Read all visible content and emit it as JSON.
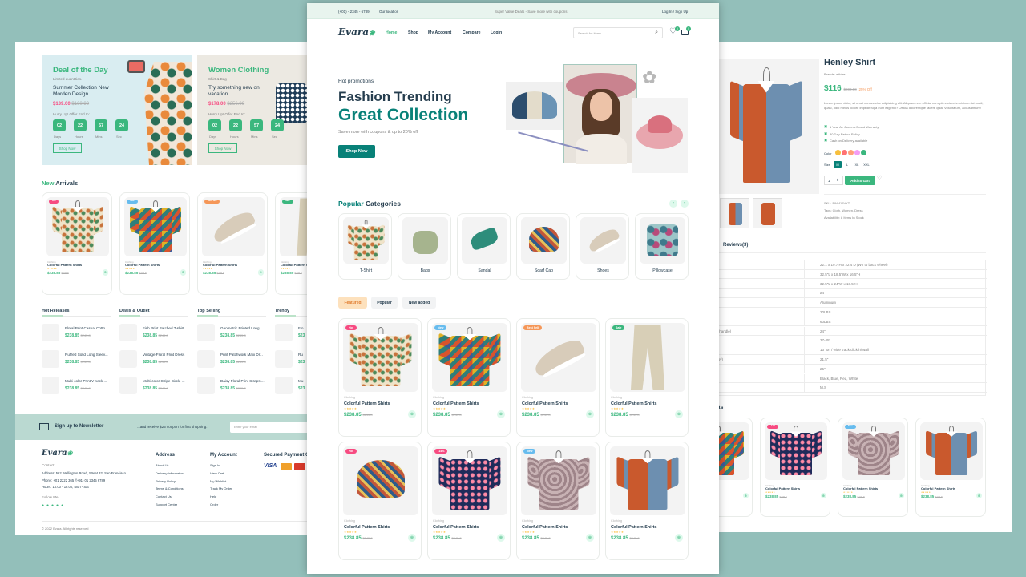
{
  "left": {
    "deal": {
      "title": "Deal of the Day",
      "sub": "Limited quantities.",
      "desc1": "Summer Collection New",
      "desc2": "Morden Design",
      "price": "$139.00",
      "old": "$160.99",
      "hurry": "Hurry Up! Offer End In:",
      "timer": [
        "02",
        "22",
        "57",
        "24"
      ],
      "labels": [
        "Days",
        "Hours",
        "Mins",
        "Sec"
      ],
      "btn": "Shop Now"
    },
    "women": {
      "title": "Women Clothing",
      "sub": "Shirt & Bag",
      "desc1": "Try something new on",
      "desc2": "vacation",
      "price": "$178.00",
      "old": "$256.99",
      "hurry": "Hurry Up! Offer End In:",
      "timer": [
        "02",
        "22",
        "57",
        "24"
      ],
      "labels": [
        "Days",
        "Hours",
        "Mins",
        "Sec"
      ],
      "btn": "Shop Now"
    },
    "arrivals_word1": "New",
    "arrivals_word2": "Arrivals",
    "cards": [
      {
        "badge": "Hot",
        "badge_color": "#f74b81",
        "cat": "Clothing",
        "name": "Colorful Pattern Shirts",
        "price": "$238.85",
        "old": "$245.8",
        "art": "pat1"
      },
      {
        "badge": "New",
        "badge_color": "#67bcee",
        "cat": "Clothing",
        "name": "Colorful Pattern Shirts",
        "price": "$238.85",
        "old": "$245.8",
        "art": "pat2"
      },
      {
        "badge": "Best Sell",
        "badge_color": "#f59758",
        "cat": "Clothing",
        "name": "Colorful Pattern Shirts",
        "price": "$238.85",
        "old": "$245.8",
        "art": "shoe"
      },
      {
        "badge": "Sale",
        "badge_color": "#3bb77e",
        "cat": "Clothing",
        "name": "Colorful Pattern Shirts",
        "price": "$238.85",
        "old": "$245.8",
        "art": "pants"
      }
    ],
    "cols": [
      {
        "title": "Hot Releases",
        "items": [
          {
            "name": "Floral Print Casual Cotto...",
            "price": "$238.85",
            "old": "$245.8"
          },
          {
            "name": "Ruffled Solid Long Sleev...",
            "price": "$238.85",
            "old": "$245.8"
          },
          {
            "name": "Multi-color Print V-neck ...",
            "price": "$238.85",
            "old": "$245.8"
          }
        ]
      },
      {
        "title": "Deals & Outlet",
        "items": [
          {
            "name": "Fish Print Patched T-shirt",
            "price": "$238.85",
            "old": "$245.8"
          },
          {
            "name": "Vintage Floral Print Dress",
            "price": "$238.85",
            "old": "$245.8"
          },
          {
            "name": "Multi-color Stripe Circle ...",
            "price": "$238.85",
            "old": "$245.8"
          }
        ]
      },
      {
        "title": "Top Selling",
        "items": [
          {
            "name": "Geometric Printed Long ...",
            "price": "$238.85",
            "old": "$245.8"
          },
          {
            "name": "Print Patchwork Maxi Dr...",
            "price": "$238.85",
            "old": "$245.8"
          },
          {
            "name": "Daisy Floral Print Straps ...",
            "price": "$238.85",
            "old": "$245.8"
          }
        ]
      },
      {
        "title": "Trendy",
        "items": [
          {
            "name": "Flo",
            "price": "$23",
            "old": ""
          },
          {
            "name": "Ru",
            "price": "$23",
            "old": ""
          },
          {
            "name": "Mu",
            "price": "$23",
            "old": ""
          }
        ]
      }
    ],
    "newsletter": {
      "label": "Sign up to Newsletter",
      "note": "...and receive $25 coupon for first shopping.",
      "placeholder": "Enter your email"
    },
    "footer": {
      "logo": "Evara",
      "contact": "Contact",
      "address": "Address: 562 Wellington Road, Street 32, San Francisco",
      "phone": "Phone: +01 2222 365 /(+91) 01 2345 6789",
      "hours": "Hours: 10:00 - 18:00, Mon - Sat",
      "follow": "Follow Me",
      "addr_title": "Address",
      "addr_links": [
        "About Us",
        "Delivery Information",
        "Privacy Policy",
        "Terms & Conditions",
        "Contact Us",
        "Support Center"
      ],
      "acct_title": "My Account",
      "acct_links": [
        "Sign In",
        "View Cart",
        "My Wishlist",
        "Track My Order",
        "Help",
        "Order"
      ],
      "pay_title": "Secured Payment G",
      "copyright": "© 2022 Evara. All rights reserved"
    }
  },
  "center": {
    "topbar": {
      "phone": "(+01) - 2345 - 6789",
      "location": "Our location",
      "promo": "Super Value Deals - Save more with coupons",
      "auth": "Log In / Sign Up"
    },
    "logo": "Evara",
    "nav": [
      "Home",
      "Shop",
      "My Account",
      "Compare",
      "Login"
    ],
    "search_placeholder": "Search for items...",
    "wishlist_count": "0",
    "cart_count": "0",
    "hero": {
      "kicker": "Hot promotions",
      "title1": "Fashion Trending",
      "title2": "Great Collection",
      "sub": "Save more with coupons & up to 20% off",
      "btn": "Shop Now"
    },
    "cat_word1": "Popular",
    "cat_word2": "Categories",
    "categories": [
      {
        "name": "T-Shirt",
        "art": "pat1"
      },
      {
        "name": "Bags",
        "art": "bag"
      },
      {
        "name": "Sandal",
        "art": "sandal"
      },
      {
        "name": "Scarf Cap",
        "art": "hat"
      },
      {
        "name": "Shoes",
        "art": "shoe"
      },
      {
        "name": "Pillowcase",
        "art": "pillow"
      }
    ],
    "tabs": [
      "Featured",
      "Popular",
      "New added"
    ],
    "products": [
      {
        "badge": "Hot",
        "badge_color": "#f74b81",
        "cat": "Clothing",
        "name": "Colorful Pattern Shirts",
        "price": "$238.85",
        "old": "$245.8",
        "art": "pat1"
      },
      {
        "badge": "New",
        "badge_color": "#67bcee",
        "cat": "Clothing",
        "name": "Colorful Pattern Shirts",
        "price": "$238.85",
        "old": "$245.8",
        "art": "pat2"
      },
      {
        "badge": "Best Sell",
        "badge_color": "#f59758",
        "cat": "Clothing",
        "name": "Colorful Pattern Shirts",
        "price": "$238.85",
        "old": "$245.8",
        "art": "shoe"
      },
      {
        "badge": "Sale",
        "badge_color": "#3bb77e",
        "cat": "Clothing",
        "name": "Colorful Pattern Shirts",
        "price": "$238.85",
        "old": "$245.8",
        "art": "pants"
      },
      {
        "badge": "Hot",
        "badge_color": "#f74b81",
        "cat": "Clothing",
        "name": "Colorful Pattern Shirts",
        "price": "$238.85",
        "old": "$245.8",
        "art": "hat"
      },
      {
        "badge": "-14%",
        "badge_color": "#f74b81",
        "cat": "Clothing",
        "name": "Colorful Pattern Shirts",
        "price": "$238.85",
        "old": "$245.8",
        "art": "pat3"
      },
      {
        "badge": "New",
        "badge_color": "#67bcee",
        "cat": "Clothing",
        "name": "Colorful Pattern Shirts",
        "price": "$238.85",
        "old": "$245.8",
        "art": "pat4"
      },
      {
        "badge": "",
        "badge_color": "",
        "cat": "Clothing",
        "name": "Colorful Pattern Shirts",
        "price": "$238.85",
        "old": "$245.8",
        "art": "pat5"
      }
    ]
  },
  "right": {
    "title": "Henley Shirt",
    "brand": "Brands: adidas",
    "price": "$116",
    "old": "$200.00",
    "off": "25% Off",
    "desc": "Lorem ipsum dolor, sit amet consectetur adipisicing elit. Aliquam rem officia, corrupti reiciendis minima nisi modi, quasi, odio minus dolore impedit fuga eum eligendi? Officia doloremque facere quia. Voluptatum, accusantium!",
    "features": [
      "1 Year AL Jazeera Brand Warranty",
      "30 Day Return Policy",
      "Cash on Delivery available"
    ],
    "color_label": "Color",
    "colors": [
      "#f7bf3d",
      "#ff7272",
      "#ff9f7a",
      "#f39cf4",
      "#3bb77e"
    ],
    "size_label": "Size",
    "sizes": [
      "M",
      "L",
      "XL",
      "XXL"
    ],
    "qty": "1",
    "add_btn": "Add to cart",
    "sku": "SKU: FWM15VKT",
    "tags": "Tags: Cloth, Women, Dress",
    "avail": "Availability: 8 Items In Stock",
    "reviews": "Reviews(3)",
    "spec_rows": [
      "",
      "",
      "",
      "",
      "",
      "",
      "",
      "",
      "",
      "",
      "",
      ""
    ],
    "spec_vals": [
      "22.1 x 19.7 H x 22.4 D (Wh to back wheel)",
      "32.5\"L x 18.5\"W x 16.5\"H",
      "32.5\"L x 24\"W x 18.5\"H",
      "24",
      "Aluminum",
      "20LBS",
      "60LBS",
      "24\"",
      "37-45\"",
      "13\" on / wide track click hi-wall",
      "21.5\"",
      "25\"",
      "Black, Blue, Red, White",
      "M,S"
    ],
    "spec_labels": {
      "r7": "... nd to handle)",
      "r10": "... canopy)"
    },
    "related": "ducts",
    "rel_cards": [
      {
        "cat": "",
        "name": "rts",
        "price": "",
        "old": "",
        "art": "pat2"
      },
      {
        "badge": "-14%",
        "badge_color": "#f74b81",
        "cat": "Clothing",
        "name": "Colorful Pattern Shirts",
        "price": "$238.85",
        "old": "$245.8",
        "art": "pat3"
      },
      {
        "badge": "New",
        "badge_color": "#67bcee",
        "cat": "Clothing",
        "name": "Colorful Pattern Shirts",
        "price": "$238.85",
        "old": "$245.8",
        "art": "pat4"
      },
      {
        "badge": "",
        "badge_color": "",
        "cat": "Clothing",
        "name": "Colorful Pattern Shirts",
        "price": "$238.85",
        "old": "$245.8",
        "art": "pat5"
      }
    ]
  }
}
